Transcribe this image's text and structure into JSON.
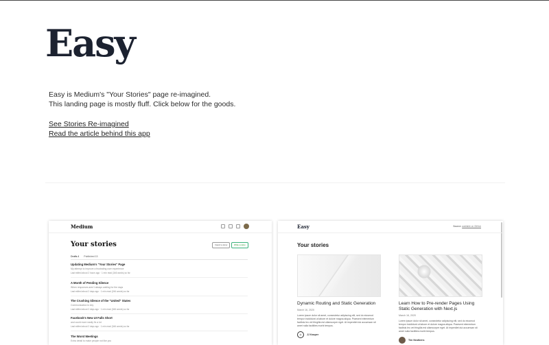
{
  "brand": {
    "logo": "Easy"
  },
  "intro": {
    "line1": "Easy is Medium's \"Your Stories\" page re-imagined.",
    "line2": "This landing page is mostly fluff. Click below for the goods."
  },
  "links": [
    {
      "label": "See Stories Re-imagined"
    },
    {
      "label": "Read the article behind this app"
    }
  ],
  "preview_medium": {
    "logo": "Medium",
    "title": "Your stories",
    "import_button": "Import a story",
    "write_button": "Write a story",
    "tabs": [
      "Drafts 4",
      "Published 13"
    ],
    "stories": [
      {
        "title": "Updating Medium's \"Your Stories\" Page",
        "subtitle": "My attempt to improve a frustrating user experience",
        "meta": "Last edited about 2 hours ago · 1 min read (346 words) so far"
      },
      {
        "title": "A Month of Pending Silence",
        "subtitle": "When responses aren't always waiting for the days",
        "meta": "Last edited about 2 days ago · 1 min read (246 words) so far"
      },
      {
        "title": "The Crushing Silence of the \"United\" States",
        "subtitle": "Communication is key",
        "meta": "Last edited about 2 days ago · 1 min read (346 words) so far"
      },
      {
        "title": "Facebook's New UI Falls Short",
        "subtitle": "and could more easily fix a lot",
        "meta": "Last edited about 2 days ago · 1 min read (346 words) so far"
      },
      {
        "title": "The Worst Meetings",
        "subtitle": "Extra detail to make people not like you",
        "meta": ""
      }
    ]
  },
  "preview_easy": {
    "logo": "Easy",
    "source_prefix": "Source:",
    "source_link": "available on GitHub",
    "title": "Your stories",
    "cards": [
      {
        "title": "Dynamic Routing and Static Generation",
        "date": "March 16, 2020",
        "excerpt": "Lorem ipsum dolor sit amet, consectetur adipiscing elit, sed do eiusmod tempor incididunt ut labore et dolore magna aliqua. Praesent elementum facilisis leo vel fringilla est ullamcorper eget. At imperdiet dui accumsan sit amet nulla facilities morbi tempus.",
        "author": "JJ Kasper",
        "avatar_glyph": "◇"
      },
      {
        "title": "Learn How to Pre-render Pages Using Static Generation with Next.js",
        "date": "March 16, 2020",
        "excerpt": "Lorem ipsum dolor sit amet, consectetur adipiscing elit, sed do eiusmod tempor incididunt ut labore et dolore magna aliqua. Praesent elementum facilisis leo vel fringilla est ullamcorper eget. At imperdiet dui accumsan sit amet nulla facilities morbi tempus.",
        "author": "Tim Neutkens",
        "avatar_glyph": ""
      }
    ]
  }
}
